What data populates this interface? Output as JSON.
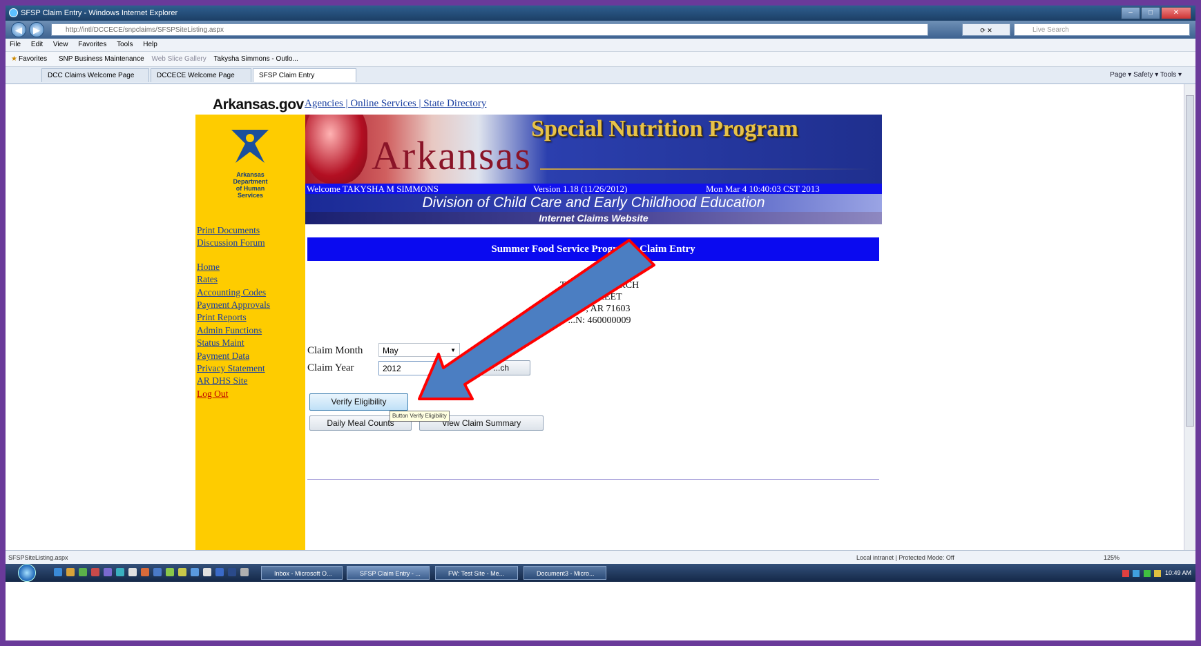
{
  "browser": {
    "title": "SFSP Claim Entry - Windows Internet Explorer",
    "url": "http://intl/DCCECE/snpclaims/SFSPSiteListing.aspx",
    "search_placeholder": "Live Search",
    "menu": [
      "File",
      "Edit",
      "View",
      "Favorites",
      "Tools",
      "Help"
    ],
    "favorites_label": "Favorites",
    "favorites_items": [
      "SNP Business Maintenance",
      "Web Slice Gallery",
      "Takysha Simmons - Outlo..."
    ],
    "tabs": [
      "DCC Claims Welcome Page",
      "DCCECE Welcome Page",
      "SFSP Claim Entry"
    ],
    "command_bar": "Page ▾   Safety ▾   Tools ▾"
  },
  "page": {
    "brand": "Arkansas.gov",
    "top_links": "Agencies | Online Services | State Directory",
    "dhs_text": [
      "Arkansas",
      "Department",
      "of Human",
      "Services"
    ],
    "sidebar_links_top": [
      "Print Documents",
      "Discussion Forum"
    ],
    "sidebar_links": [
      "Home",
      "Rates",
      "Accounting Codes",
      "Payment Approvals",
      "Print Reports",
      "Admin Functions",
      "Status Maint",
      "Payment Data",
      "Privacy Statement",
      "AR DHS Site"
    ],
    "logout": "Log Out",
    "banner_state": "Arkansas",
    "banner_program": "Special Nutrition Program",
    "welcome": "Welcome TAKYSHA M SIMMONS",
    "version": "Version 1.18 (11/26/2012)",
    "datetime": "Mon Mar 4 10:40:03 CST 2013",
    "division": "Division of Child Care and Early Childhood Education",
    "subtitle": "Internet Claims Website",
    "section_title": "Summer Food Service Program - Claim Entry",
    "sponsor": {
      "name": "TA290 ... CHURCH",
      "street": "... STREET",
      "city": "...FF, AR 71603",
      "ein": "...N: 460000009"
    },
    "form": {
      "claim_month_label": "Claim Month",
      "claim_month_value": "May",
      "claim_year_label": "Claim Year",
      "claim_year_value": "2012",
      "search_label": "...ch"
    },
    "buttons": {
      "verify": "Verify Eligibility",
      "daily": "Daily Meal Counts",
      "summary": "View Claim Summary"
    },
    "tooltip": "Button Verify Eligibility"
  },
  "status": {
    "left": "SFSPSiteListing.aspx",
    "zone": "Local intranet | Protected Mode: Off",
    "zoom": "125%"
  },
  "taskbar": {
    "buttons": [
      "Inbox - Microsoft O...",
      "SFSP Claim Entry - ...",
      "FW: Test Site - Me...",
      "Document3 - Micro..."
    ],
    "clock": "10:49 AM"
  },
  "colors": {
    "sidebar": "#fecc00",
    "header_blue": "#0a0af0",
    "link": "#1a3fa0",
    "logout": "#c00000",
    "arrow_fill": "#4b7ec2",
    "arrow_outline": "#ff0000",
    "frame": "#6a3a9a"
  }
}
